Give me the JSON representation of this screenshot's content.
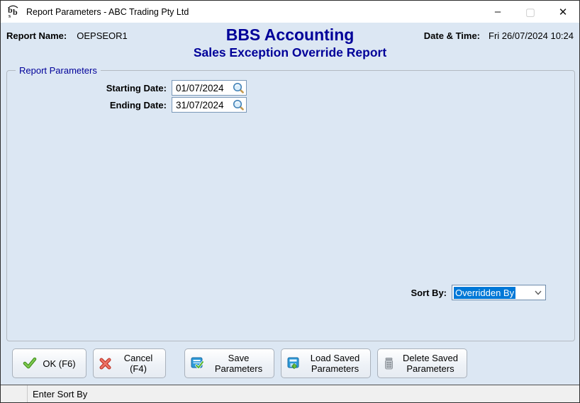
{
  "window": {
    "title": "Report Parameters - ABC Trading Pty Ltd",
    "controls": {
      "minimize": "–",
      "maximize": "▢",
      "close": "✕"
    }
  },
  "header": {
    "report_name_label": "Report Name:",
    "report_name_value": "OEPSEOR1",
    "app_title": "BBS Accounting",
    "report_title": "Sales Exception Override Report",
    "datetime_label": "Date & Time:",
    "datetime_value": "Fri 26/07/2024 10:24"
  },
  "parameters": {
    "group_label": "Report Parameters",
    "starting_date": {
      "label": "Starting Date:",
      "value": "01/07/2024"
    },
    "ending_date": {
      "label": "Ending Date:",
      "value": "31/07/2024"
    },
    "sort_by": {
      "label": "Sort By:",
      "value": "Overridden By"
    }
  },
  "buttons": {
    "ok": "OK (F6)",
    "cancel": "Cancel (F4)",
    "save": "Save Parameters",
    "load": "Load Saved Parameters",
    "delete": "Delete Saved Parameters"
  },
  "status_bar": {
    "message": "Enter Sort By"
  },
  "icons": {
    "app": "bbs-logo-icon",
    "date_lookup": "magnifier-icon",
    "ok": "green-check-icon",
    "cancel": "red-cross-icon",
    "save": "save-disk-check-icon",
    "load": "load-disk-arrow-icon",
    "delete": "trash-icon",
    "combo": "chevron-down-icon"
  },
  "colors": {
    "body_bg": "#dce7f3",
    "titlebar_bg": "#ffffff",
    "accent_navy": "#000099",
    "selection_blue": "#0078d7",
    "input_border": "#7a98b8",
    "statusbar_bg": "#f0f0f0"
  }
}
